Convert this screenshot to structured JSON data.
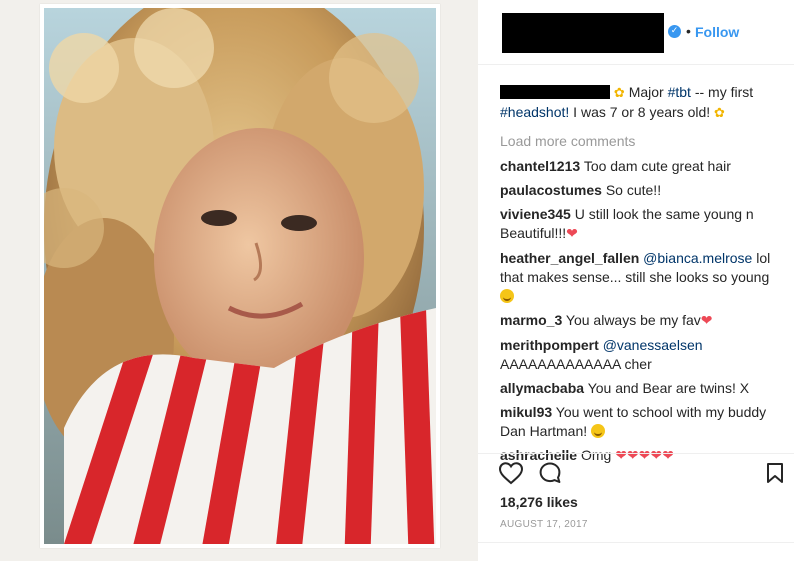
{
  "header": {
    "follow_label": "Follow",
    "dot": "•"
  },
  "caption": {
    "text_1": "Major ",
    "hashtag_1": "#tbt",
    "text_2": " -- my first ",
    "hashtag_2": "#headshot!",
    "text_3": " I was 7 or 8 years old! "
  },
  "load_more_label": "Load more comments",
  "comments": [
    {
      "user": "chantel1213",
      "text": "Too dam cute great hair"
    },
    {
      "user": "paulacostumes",
      "text": "So cute!!"
    },
    {
      "user": "viviene345",
      "text": "U still look the same young n Beautiful!!!"
    },
    {
      "user": "heather_angel_fallen",
      "mention": "@bianca.melrose",
      "text": "lol that makes sense... still she looks so young"
    },
    {
      "user": "marmo_3",
      "text": "You always be my fav"
    },
    {
      "user": "merithpompert",
      "mention": "@vanessaelsen",
      "text": "AAAAAAAAAAAAA cher"
    },
    {
      "user": "allymacbaba",
      "text": "You and Bear are twins! X"
    },
    {
      "user": "mikul93",
      "text": "You went to school with my buddy Dan Hartman!"
    },
    {
      "user": "ashrachelle",
      "text": "Omg"
    }
  ],
  "icons": {
    "heart": "❤",
    "sunflower": "✿"
  },
  "likes_label": "18,276 likes",
  "date_label": "AUGUST 17, 2017",
  "colors": {
    "link": "#3897f0",
    "hashtag": "#003569",
    "muted": "#999999",
    "heart": "#ed4956"
  }
}
